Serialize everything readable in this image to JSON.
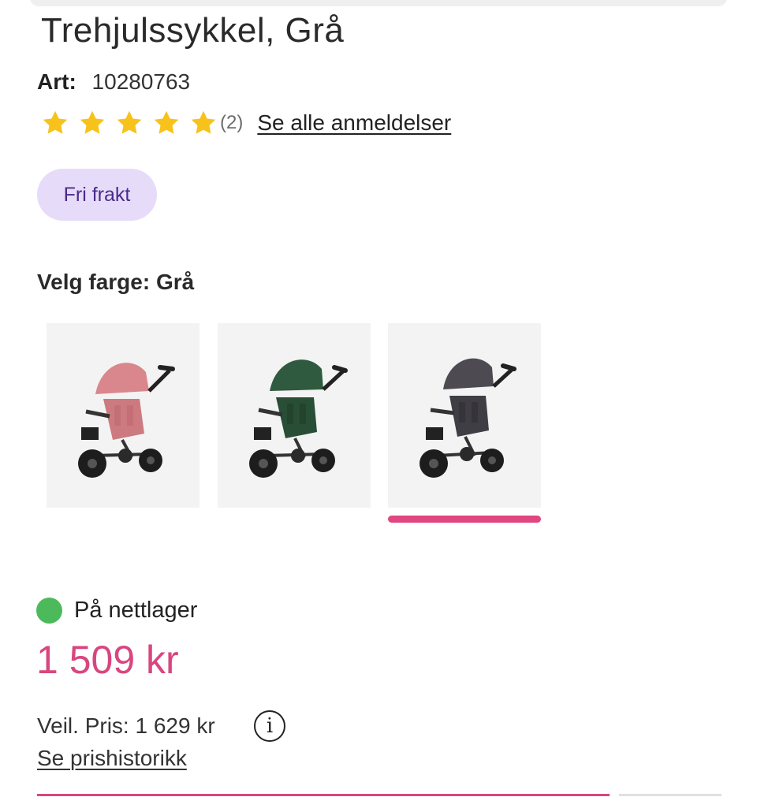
{
  "product": {
    "title": "Trehjulssykkel, Grå",
    "art_label": "Art:",
    "art_number": "10280763"
  },
  "rating": {
    "stars": 5,
    "count_text": "(2)",
    "link_text": "Se alle anmeldelser",
    "star_color": "#f7c21c"
  },
  "badge": {
    "label": "Fri frakt",
    "bg_color": "#e6dcfa",
    "text_color": "#4b2a8a"
  },
  "color_picker": {
    "heading": "Velg farge: Grå",
    "options": [
      {
        "name": "Rosa",
        "color": "#d9878c",
        "selected": false
      },
      {
        "name": "Grønn",
        "color": "#2f5a3f",
        "selected": false
      },
      {
        "name": "Grå",
        "color": "#4d4a52",
        "selected": true
      }
    ],
    "selected_indicator_color": "#e0467f"
  },
  "stock": {
    "text": "På nettlager",
    "dot_color": "#4cba5a"
  },
  "price": {
    "current": "1 509 kr",
    "current_color": "#d8467f",
    "recommended": "Veil. Pris: 1 629 kr",
    "history_link": "Se prishistorikk",
    "info_icon": "info-icon",
    "info_glyph": "i"
  }
}
